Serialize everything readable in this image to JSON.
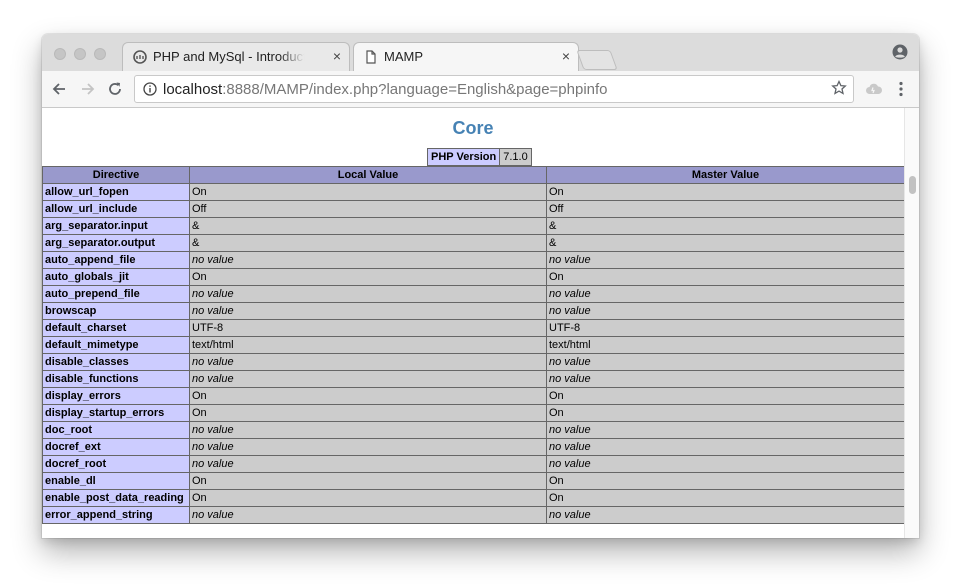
{
  "browser": {
    "tabs": [
      {
        "title": "PHP and MySql - Introduction to PHP",
        "active": false,
        "close": "×"
      },
      {
        "title": "MAMP",
        "active": true,
        "close": "×"
      }
    ],
    "url": {
      "host": "localhost",
      "rest": ":8888/MAMP/index.php?language=English&page=phpinfo"
    }
  },
  "page": {
    "heading": "Core",
    "version_label": "PHP Version",
    "version_value": "7.1.0",
    "columns": [
      "Directive",
      "Local Value",
      "Master Value"
    ],
    "rows": [
      [
        "allow_url_fopen",
        "On",
        "On"
      ],
      [
        "allow_url_include",
        "Off",
        "Off"
      ],
      [
        "arg_separator.input",
        "&",
        "&"
      ],
      [
        "arg_separator.output",
        "&",
        "&"
      ],
      [
        "auto_append_file",
        "no value",
        "no value"
      ],
      [
        "auto_globals_jit",
        "On",
        "On"
      ],
      [
        "auto_prepend_file",
        "no value",
        "no value"
      ],
      [
        "browscap",
        "no value",
        "no value"
      ],
      [
        "default_charset",
        "UTF-8",
        "UTF-8"
      ],
      [
        "default_mimetype",
        "text/html",
        "text/html"
      ],
      [
        "disable_classes",
        "no value",
        "no value"
      ],
      [
        "disable_functions",
        "no value",
        "no value"
      ],
      [
        "display_errors",
        "On",
        "On"
      ],
      [
        "display_startup_errors",
        "On",
        "On"
      ],
      [
        "doc_root",
        "no value",
        "no value"
      ],
      [
        "docref_ext",
        "no value",
        "no value"
      ],
      [
        "docref_root",
        "no value",
        "no value"
      ],
      [
        "enable_dl",
        "On",
        "On"
      ],
      [
        "enable_post_data_reading",
        "On",
        "On"
      ],
      [
        "error_append_string",
        "no value",
        "no value"
      ]
    ]
  },
  "colors": {
    "heading": "#4682b4",
    "header_row": "#9999cc",
    "directive_cell": "#ccccff",
    "value_cell": "#cccccc"
  }
}
